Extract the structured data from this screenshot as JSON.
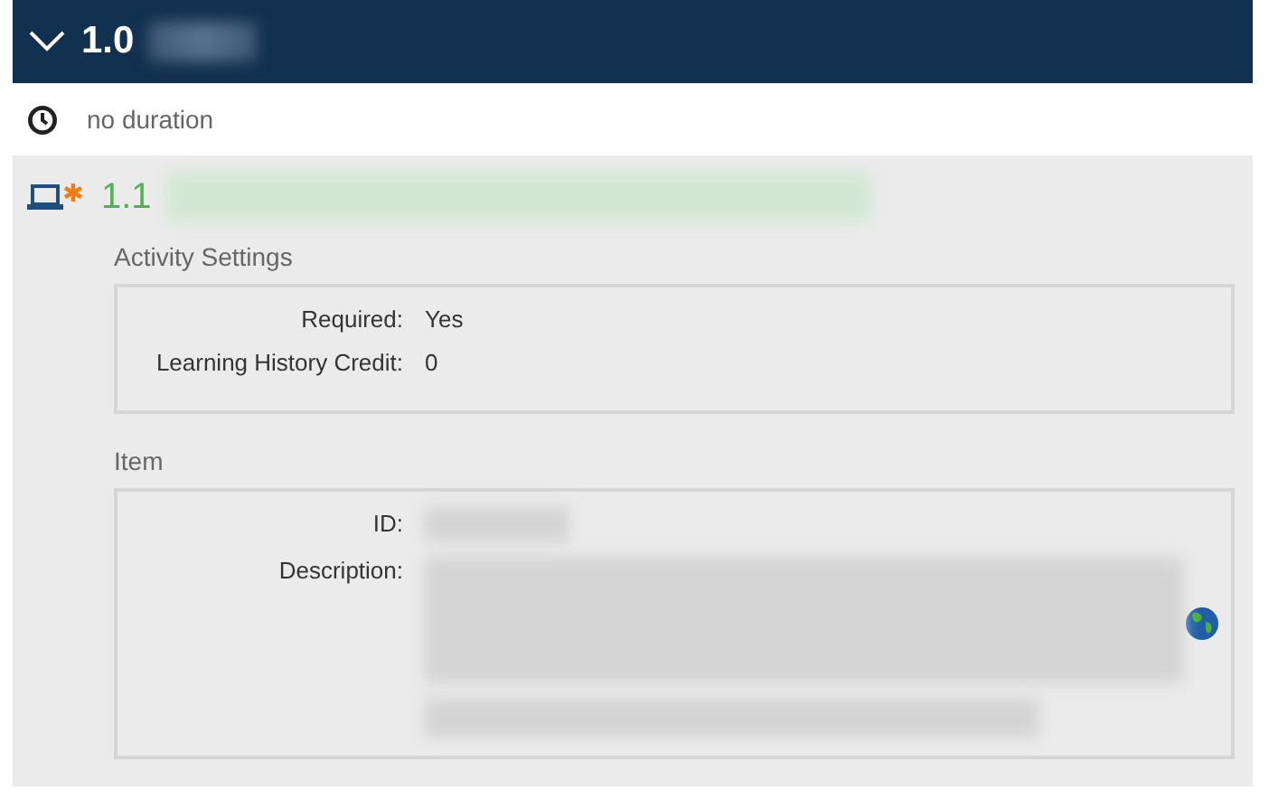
{
  "header": {
    "number": "1.0",
    "expanded": true
  },
  "duration": "no duration",
  "activity": {
    "number": "1.1",
    "required": true
  },
  "activity_settings": {
    "title": "Activity Settings",
    "fields": [
      {
        "label": "Required:",
        "value": "Yes"
      },
      {
        "label": "Learning History Credit:",
        "value": "0"
      }
    ]
  },
  "item": {
    "title": "Item",
    "fields": [
      {
        "label": "ID:"
      },
      {
        "label": "Description:"
      }
    ]
  }
}
